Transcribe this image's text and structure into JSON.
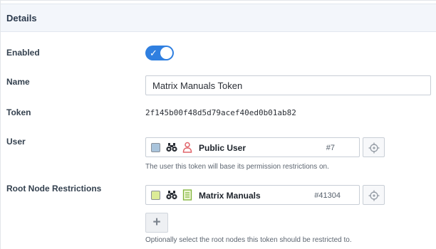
{
  "panel": {
    "title": "Details"
  },
  "fields": {
    "enabled": {
      "label": "Enabled",
      "value": true,
      "check": "✓"
    },
    "name": {
      "label": "Name",
      "value": "Matrix Manuals Token"
    },
    "token": {
      "label": "Token",
      "value": "2f145b00f48d5d79acef40ed0b01ab82"
    },
    "user": {
      "label": "User",
      "asset_name": "Public User",
      "asset_id": "#7",
      "swatch_color": "#a9c4dc",
      "type_icon": "user-icon",
      "help": "The user this token will base its permission restrictions on."
    },
    "root_node": {
      "label": "Root Node Restrictions",
      "asset_name": "Matrix Manuals",
      "asset_id": "#41304",
      "swatch_color": "#dcec98",
      "type_icon": "page-icon",
      "add_label": "+",
      "help": "Optionally select the root nodes this token should be restricted to."
    }
  },
  "colors": {
    "accent": "#2f7fe0",
    "header_bg": "#f3f6fb"
  }
}
